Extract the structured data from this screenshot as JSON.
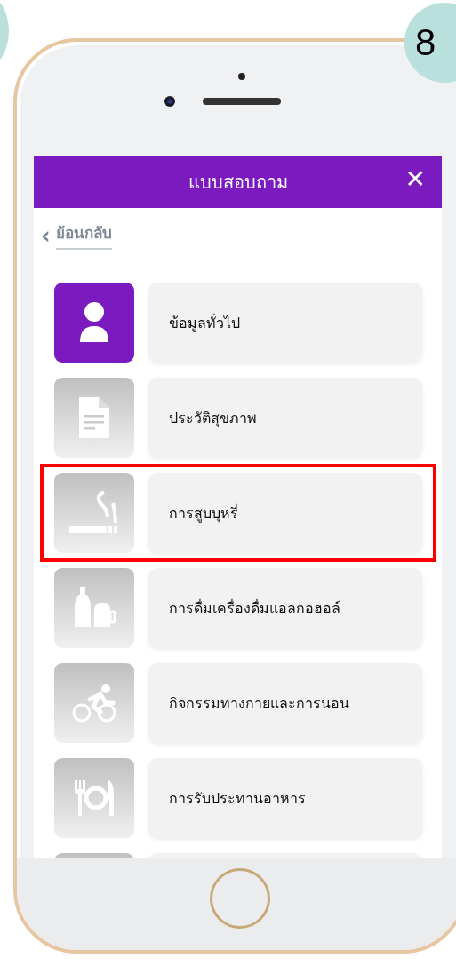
{
  "step_badge": "8",
  "header": {
    "title": "แบบสอบถาม",
    "close": "✕"
  },
  "back_link": {
    "arrow": "‹",
    "label": "ย้อนกลับ"
  },
  "menu_items": [
    {
      "label": "ข้อมูลทั่วไป",
      "active": true,
      "highlighted": false
    },
    {
      "label": "ประวัติสุขภาพ",
      "active": false,
      "highlighted": false
    },
    {
      "label": "การสูบบุหรี่",
      "active": false,
      "highlighted": true
    },
    {
      "label": "การดื่มเครื่องดื่มแอลกอฮอล์",
      "active": false,
      "highlighted": false
    },
    {
      "label": "กิจกรรมทางกายและการนอน",
      "active": false,
      "highlighted": false
    },
    {
      "label": "การรับประทานอาหาร",
      "active": false,
      "highlighted": false
    }
  ]
}
